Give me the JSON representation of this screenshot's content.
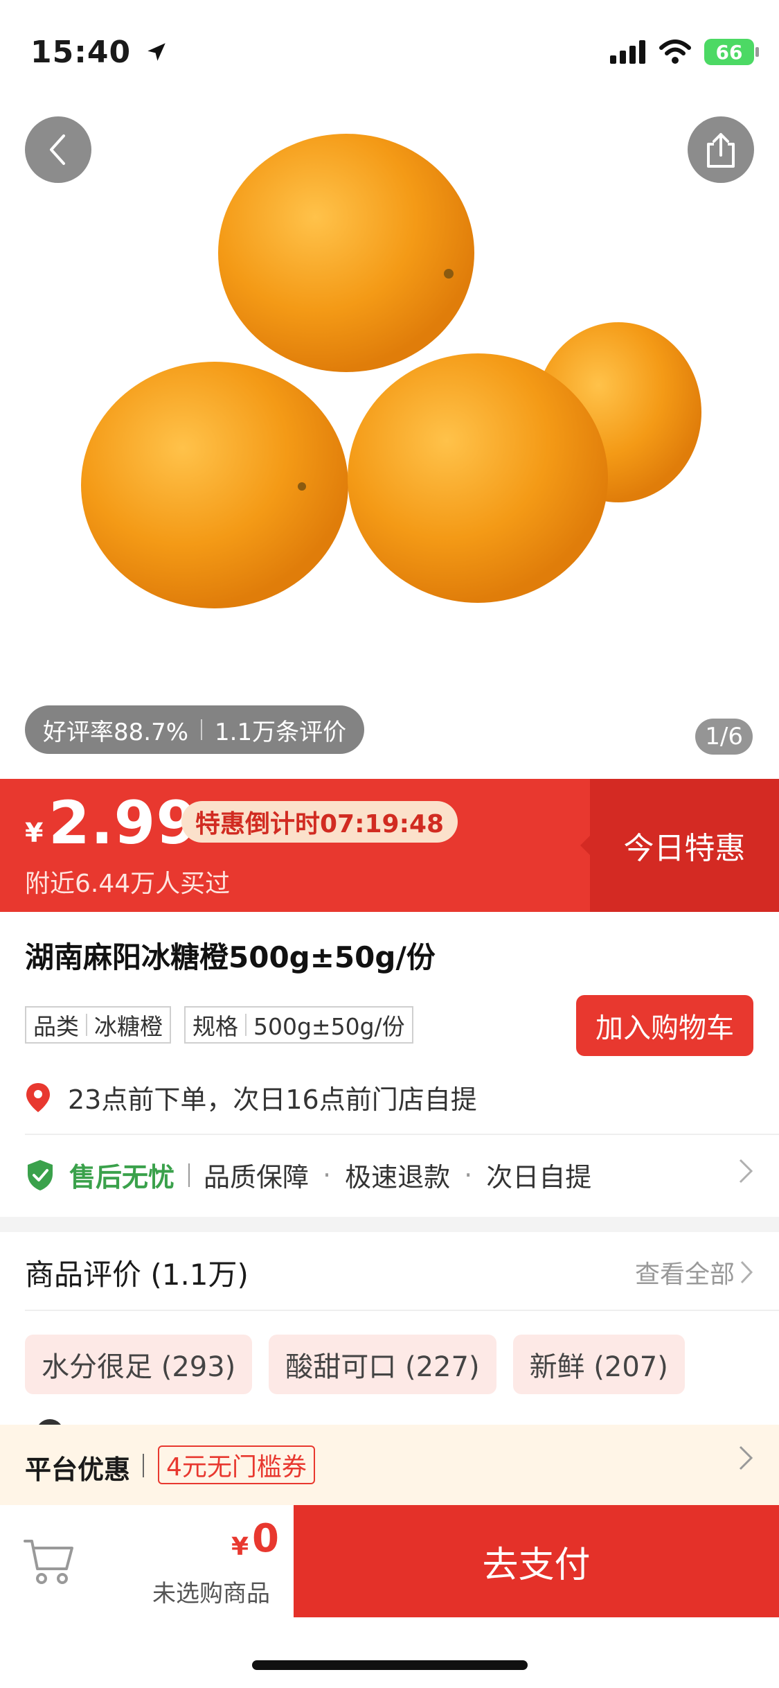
{
  "status_bar": {
    "time": "15:40",
    "battery": "66"
  },
  "gallery": {
    "page_indicator": "1/6"
  },
  "rating": {
    "good_rate": "好评率88.7%",
    "review_count": "1.1万条评价"
  },
  "price_banner": {
    "currency": "¥",
    "price": "2.99",
    "countdown": "特惠倒计时07:19:48",
    "bought": "附近6.44万人买过",
    "today_special": "今日特惠"
  },
  "product": {
    "title": "湖南麻阳冰糖橙500g±50g/份",
    "spec_category_label": "品类",
    "spec_category_value": "冰糖橙",
    "spec_size_label": "规格",
    "spec_size_value": "500g±50g/份",
    "add_to_cart": "加入购物车",
    "pickup": "23点前下单，次日16点前门店自提"
  },
  "guarantee": {
    "title": "售后无忧",
    "items": [
      "品质保障",
      "·",
      "极速退款",
      "·",
      "次日自提"
    ]
  },
  "reviews": {
    "title": "商品评价 (1.1万)",
    "see_all": "查看全部",
    "tags": [
      "水分很足 (293)",
      "酸甜可口 (227)",
      "新鲜 (207)"
    ]
  },
  "offer": {
    "label": "平台优惠",
    "coupon": "4元无门槛券"
  },
  "bottom_bar": {
    "currency": "¥",
    "total": "0",
    "status": "未选购商品",
    "pay": "去支付"
  },
  "colors": {
    "brand_red": "#e8382f",
    "green": "#3aa14b",
    "orange": "#f39a1b"
  },
  "icons": [
    "location-arrow-icon",
    "signal-icon",
    "wifi-icon",
    "battery-icon",
    "back-icon",
    "share-icon",
    "location-pin-icon",
    "shield-check-icon",
    "chevron-right-icon",
    "cart-icon"
  ]
}
